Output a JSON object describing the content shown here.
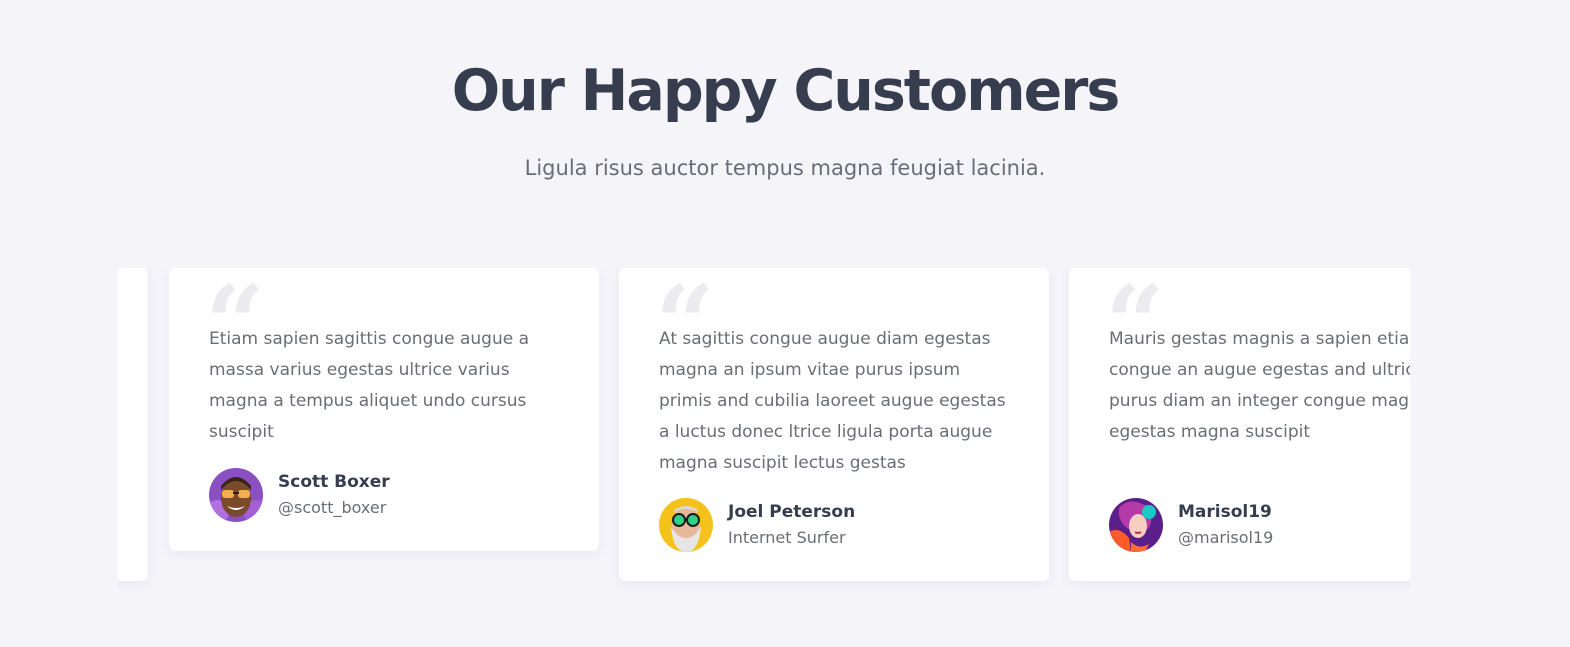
{
  "section": {
    "title": "Our Happy Customers",
    "subtitle": "Ligula risus auctor tempus magna feugiat lacinia."
  },
  "testimonials": [
    {
      "text": "Etiam sapien sagittis congue augue a massa varius egestas ultrice varius magna a tempus aliquet undo cursus suscipit",
      "name": "Scott Boxer",
      "handle": "@scott_boxer",
      "avatar_icon": "avatar-man-sunglasses"
    },
    {
      "text": "At sagittis congue augue diam egestas magna an ipsum vitae purus ipsum primis and cubilia laoreet augue egestas a luctus donec ltrice ligula porta augue magna suscipit lectus gestas",
      "name": "Joel Peterson",
      "handle": "Internet Surfer",
      "avatar_icon": "avatar-bearded-man"
    },
    {
      "text": "Mauris gestas magnis a sapien etiam sapien congue an augue egestas and ultrice vitae purus diam an integer congue magna ligula egestas magna suscipit",
      "name": "Marisol19",
      "handle": "@marisol19",
      "avatar_icon": "avatar-woman-headphones"
    }
  ],
  "colors": {
    "background": "#f4f4f9",
    "card": "#ffffff",
    "heading": "#363d4f",
    "body_text": "#6b6d76",
    "quote_mark": "#ececf0"
  }
}
